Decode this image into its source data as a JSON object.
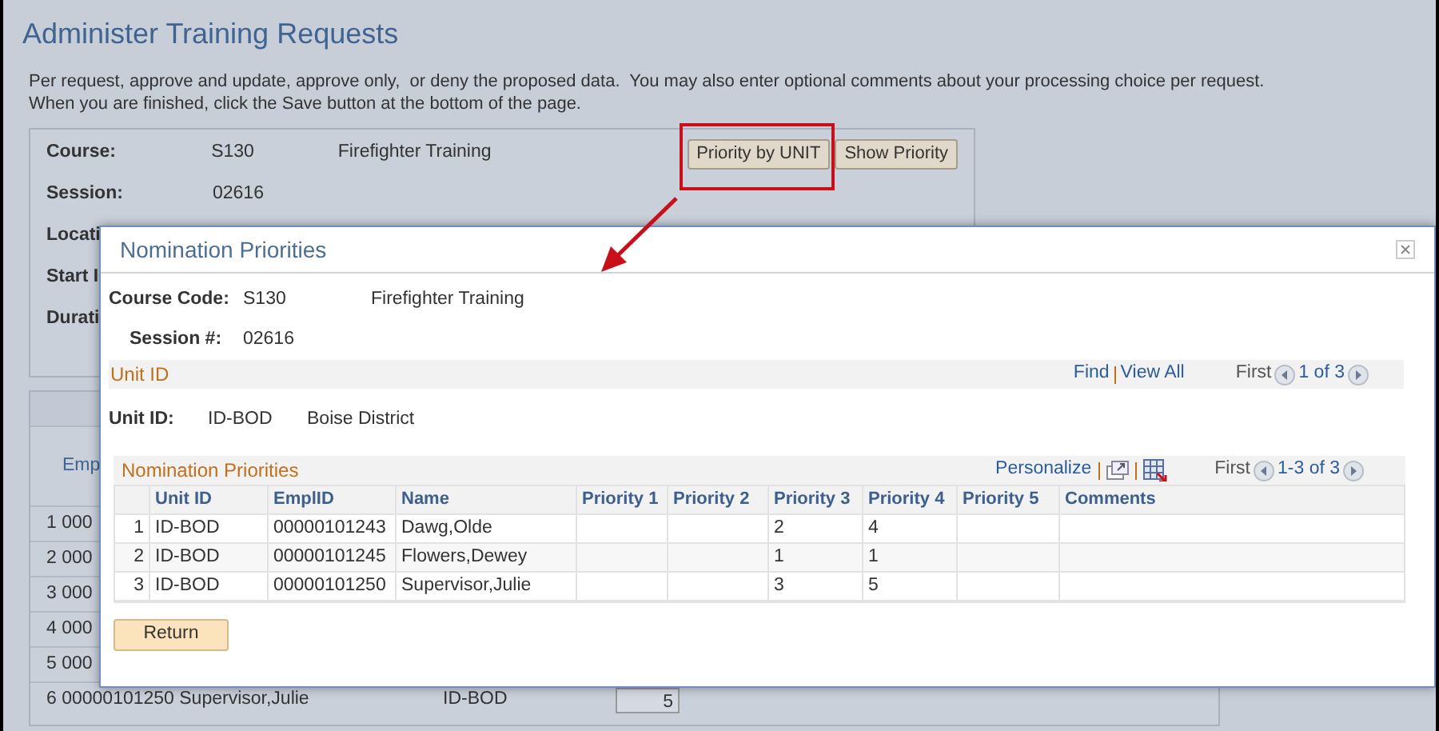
{
  "page": {
    "title": "Administer Training Requests",
    "instructions": "Per request, approve and update, approve only,  or deny the proposed data.  You may also enter optional comments about your processing choice per request.  When you are finished, click the Save button at the bottom of the page."
  },
  "course_panel": {
    "fields": [
      {
        "label": "Course:",
        "value": "S130",
        "description": "Firefighter Training"
      },
      {
        "label": "Session:",
        "value": "02616"
      },
      {
        "label": "Locati"
      },
      {
        "label": "Start I"
      },
      {
        "label": "Durati"
      }
    ],
    "buttons": [
      {
        "label": "Priority by UNIT",
        "highlighted": true
      },
      {
        "label": "Show Priority",
        "highlighted": false
      }
    ]
  },
  "requests_grid": {
    "column_1": "Emp",
    "rows": [
      "1 000",
      "2 000",
      "3 000",
      "4 000",
      "5 000"
    ],
    "last_row": {
      "number": "6",
      "emplid": "00000101250",
      "name": "Supervisor,Julie",
      "unit": "ID-BOD",
      "value": "5"
    }
  },
  "dialog": {
    "title": "Nomination Priorities",
    "course_label": "Course Code:",
    "course_code": "S130",
    "course_name": "Firefighter Training",
    "session_label": "Session #:",
    "session": "02616",
    "unit_section": {
      "title": "Unit ID",
      "links": [
        "Find",
        "View All"
      ],
      "first": "First",
      "counter": "1 of 3"
    },
    "unit": {
      "label": "Unit ID:",
      "value": "ID-BOD",
      "name": "Boise District"
    },
    "priorities": {
      "title": "Nomination Priorities",
      "personalize": "Personalize",
      "first": "First",
      "counter": "1-3 of 3",
      "columns": [
        "Unit ID",
        "EmplID",
        "Name",
        "Priority 1",
        "Priority 2",
        "Priority 3",
        "Priority 4",
        "Priority 5",
        "Comments"
      ],
      "rows": [
        {
          "number": "1",
          "cells": [
            "ID-BOD",
            "00000101243",
            "Dawg,Olde",
            "",
            "",
            "2",
            "4",
            "",
            ""
          ]
        },
        {
          "number": "2",
          "cells": [
            "ID-BOD",
            "00000101245",
            "Flowers,Dewey",
            "",
            "",
            "1",
            "1",
            "",
            ""
          ]
        },
        {
          "number": "3",
          "cells": [
            "ID-BOD",
            "00000101250",
            "Supervisor,Julie",
            "",
            "",
            "3",
            "5",
            "",
            ""
          ]
        }
      ]
    },
    "return_button": "Return"
  }
}
